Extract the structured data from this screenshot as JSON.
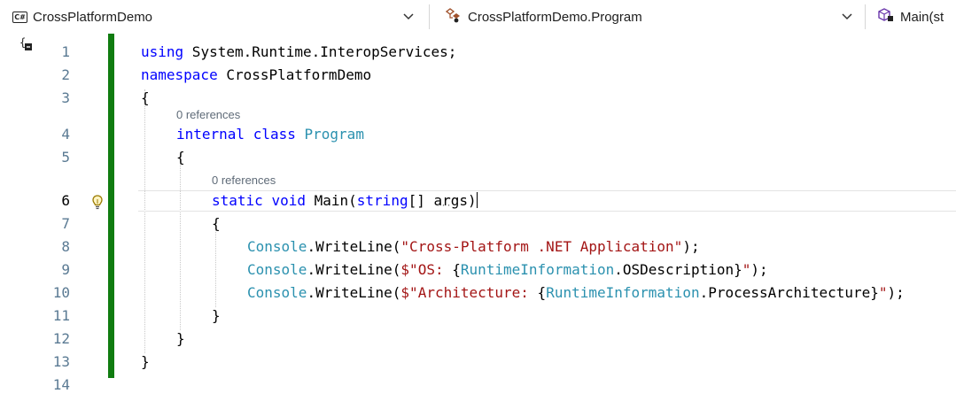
{
  "navbar": {
    "project_icon": "csharp-project-icon",
    "project": "CrossPlatformDemo",
    "type_icon": "class-icon",
    "type": "CrossPlatformDemo.Program",
    "member_icon": "method-icon",
    "member": "Main(st"
  },
  "editor": {
    "current_line": 6,
    "line_numbers": [
      "1",
      "2",
      "3",
      "4",
      "5",
      "6",
      "7",
      "8",
      "9",
      "10",
      "11",
      "12",
      "13",
      "14"
    ],
    "codelens": {
      "program_refs": "0 references",
      "main_refs": "0 references"
    },
    "code": {
      "l1_kw": "using",
      "l1_rest": " System.Runtime.InteropServices;",
      "l2_kw": "namespace",
      "l2_rest": " CrossPlatformDemo",
      "open_brace": "{",
      "close_brace": "}",
      "l4_kw1": "internal",
      "l4_kw2": "class",
      "l4_type": "Program",
      "l6_kw1": "static",
      "l6_kw2": "void",
      "l6_name": "Main",
      "l6_paren": "(",
      "l6_kw3": "string",
      "l6_brackets": "[] ",
      "l6_arg": "args",
      "l6_close": ")",
      "console": "Console",
      "dot": ".",
      "writeline": "WriteLine",
      "l8_args_open": "(",
      "l8_str": "\"Cross-Platform .NET Application\"",
      "l8_end": ");",
      "l9_str1": "$\"OS: ",
      "l9_interp_open": "{",
      "runtime_info": "RuntimeInformation",
      "l9_prop": "OSDescription",
      "l9_interp_close": "}",
      "l9_str2": "\"",
      "l10_str1": "$\"Architecture: ",
      "l10_prop": "ProcessArchitecture"
    }
  },
  "colors": {
    "keyword": "#0000ff",
    "type": "#2b91af",
    "string": "#a31515",
    "change_bar": "#107c10",
    "line_number": "#5a7a93"
  }
}
